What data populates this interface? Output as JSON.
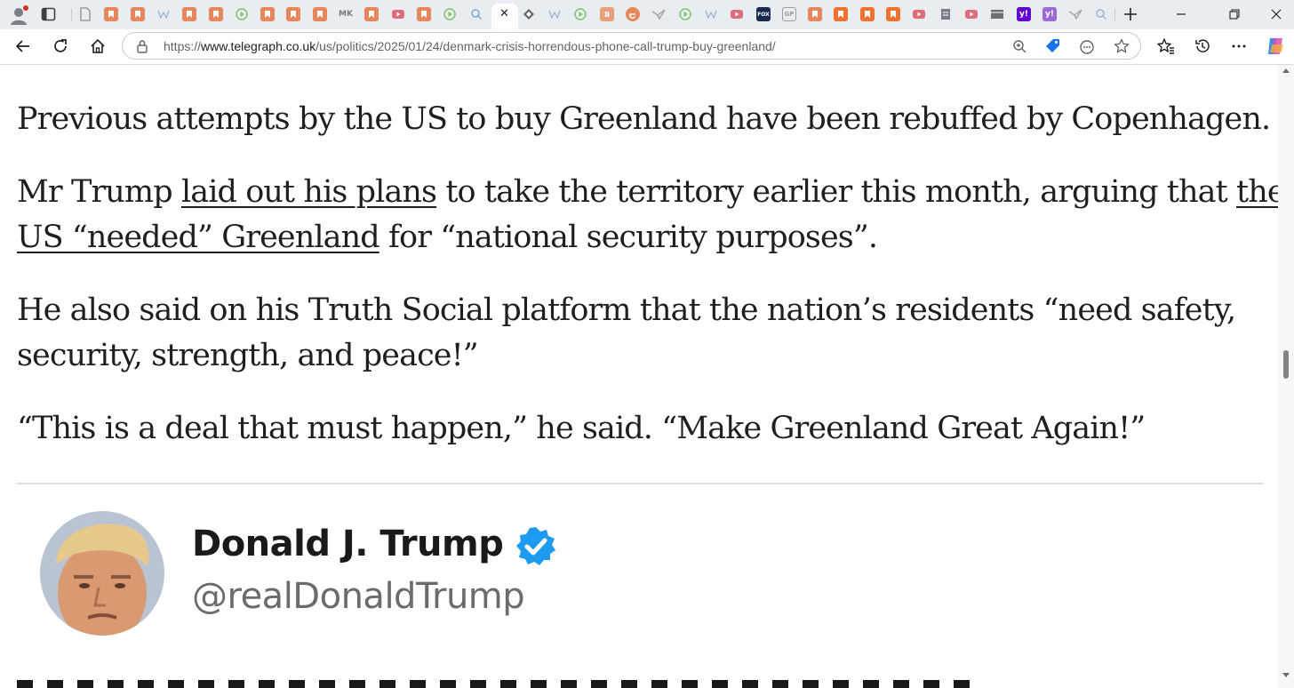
{
  "browser": {
    "url_prefix": "https://",
    "url_host": "www.telegraph.co.uk",
    "url_path": "/us/politics/2025/01/24/denmark-crisis-horrendous-phone-call-trump-buy-greenland/",
    "tab_close_glyph": "✕",
    "tabs": [
      {
        "icon": "page-icon",
        "color": "#8a8f94",
        "text": ""
      },
      {
        "icon": "bookmark-icon",
        "color": "#e8865c",
        "text": ""
      },
      {
        "icon": "bookmark-icon",
        "color": "#e8865c",
        "text": ""
      },
      {
        "icon": "wiki-icon",
        "color": "#9ab3cf",
        "text": ""
      },
      {
        "icon": "bookmark-icon",
        "color": "#e8865c",
        "text": ""
      },
      {
        "icon": "bookmark-icon",
        "color": "#e8865c",
        "text": ""
      },
      {
        "icon": "play-icon",
        "color": "#7cc36a",
        "text": ""
      },
      {
        "icon": "bookmark-icon",
        "color": "#e8865c",
        "text": ""
      },
      {
        "icon": "bookmark-icon",
        "color": "#e8865c",
        "text": ""
      },
      {
        "icon": "bookmark-icon",
        "color": "#e8865c",
        "text": ""
      },
      {
        "icon": "mk-icon",
        "color": "#7a7a7a",
        "text": "MK"
      },
      {
        "icon": "bookmark-icon",
        "color": "#e8865c",
        "text": ""
      },
      {
        "icon": "video-icon",
        "color": "#e06c7a",
        "text": ""
      },
      {
        "icon": "bookmark-icon",
        "color": "#e8865c",
        "text": ""
      },
      {
        "icon": "play-icon",
        "color": "#7cc36a",
        "text": ""
      },
      {
        "icon": "search-icon",
        "color": "#7aa7d6",
        "text": ""
      },
      {
        "icon": "diamond-icon",
        "color": "#606468",
        "text": ""
      },
      {
        "icon": "wiki-icon",
        "color": "#9ab3cf",
        "text": ""
      },
      {
        "icon": "play-icon",
        "color": "#7cc36a",
        "text": ""
      },
      {
        "icon": "b-icon",
        "color": "#e8a07c",
        "text": "B"
      },
      {
        "icon": "e-icon",
        "color": "#e8865c",
        "text": ""
      },
      {
        "icon": "bird-icon",
        "color": "#a0a4a8",
        "text": ""
      },
      {
        "icon": "play-icon",
        "color": "#7cc36a",
        "text": ""
      },
      {
        "icon": "wiki-icon",
        "color": "#9ab3cf",
        "text": ""
      },
      {
        "icon": "video-icon",
        "color": "#e06c7a",
        "text": ""
      },
      {
        "icon": "fox-icon",
        "color": "#1b2b4d",
        "text": "FOX"
      },
      {
        "icon": "gp-icon",
        "color": "#9aa0a6",
        "text": "GP"
      },
      {
        "icon": "bookmark-icon",
        "color": "#e8865c",
        "text": ""
      },
      {
        "icon": "bookmark-icon",
        "color": "#f0722e",
        "text": ""
      },
      {
        "icon": "bookmark-icon",
        "color": "#f0722e",
        "text": ""
      },
      {
        "icon": "bookmark-icon",
        "color": "#f0722e",
        "text": ""
      },
      {
        "icon": "video-icon",
        "color": "#e06c7a",
        "text": ""
      },
      {
        "icon": "doc-icon",
        "color": "#7a7a8a",
        "text": ""
      },
      {
        "icon": "video-icon",
        "color": "#e06c7a",
        "text": ""
      },
      {
        "icon": "film-icon",
        "color": "#6e6e6e",
        "text": ""
      },
      {
        "icon": "yahoo-icon",
        "color": "#6001d2",
        "text": "y!"
      },
      {
        "icon": "yahoo-icon",
        "color": "#9a6ad8",
        "text": "y!"
      },
      {
        "icon": "bird-icon",
        "color": "#a0a4a8",
        "text": ""
      },
      {
        "icon": "search-icon",
        "color": "#9ab3cf",
        "text": ""
      }
    ]
  },
  "article": {
    "para1": "Previous attempts by the US to buy Greenland have been rebuffed by Copenhagen.",
    "para2": {
      "before_link1": "Mr Trump ",
      "link1": "laid out his plans",
      "between": " to take the territory earlier this month, arguing that ",
      "link2_line1": "the",
      "link2_line2": "US “needed” Greenland",
      "after": " for “national security purposes”."
    },
    "para3": {
      "line1": "He also said on his Truth Social platform that the nation’s residents “need safety,",
      "line2": "security, strength, and peace!”"
    },
    "para4": "“This is a deal that must happen,” he said. “Make Greenland Great Again!”"
  },
  "tweet": {
    "name": "Donald J. Trump",
    "handle": "@realDonaldTrump",
    "verified_color": "#1d9bf0"
  }
}
